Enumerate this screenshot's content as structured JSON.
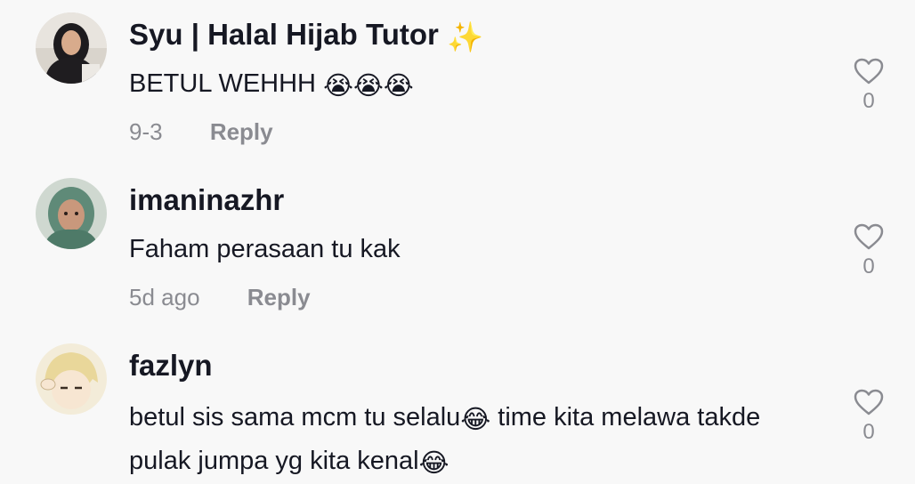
{
  "comments": [
    {
      "username": "Syu | Halal Hijab Tutor",
      "username_emoji": "✨",
      "text": "BETUL WEHHH ",
      "text_emoji": "😭😭😭",
      "time": "9-3",
      "reply_label": "Reply",
      "like_count": "0"
    },
    {
      "username": "imaninazhr",
      "text": "Faham perasaan tu kak",
      "time": "5d ago",
      "reply_label": "Reply",
      "like_count": "0"
    },
    {
      "username": "fazlyn",
      "text_line1_a": "betul sis sama mcm tu selalu",
      "text_line1_emoji": "😂",
      "text_line1_b": " time kita melawa takde",
      "text_line2": "pulak jumpa yg kita kenal",
      "text_line2_emoji": "😂",
      "like_count": "0"
    }
  ],
  "colors": {
    "background": "#f8f8f8",
    "text": "#161823",
    "muted": "#8a8b91"
  }
}
